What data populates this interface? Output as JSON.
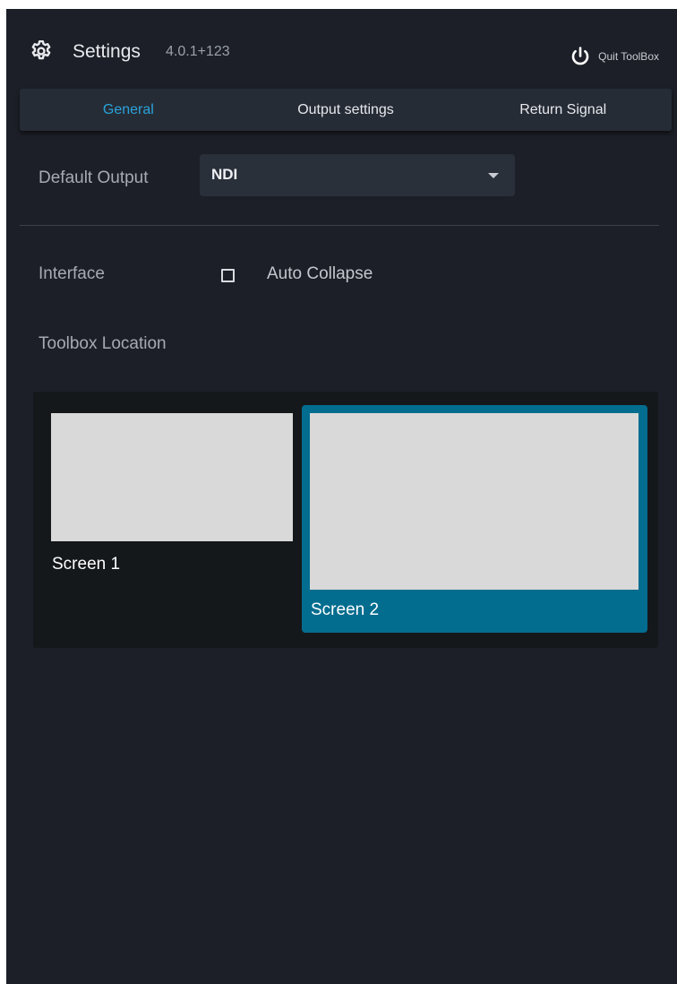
{
  "header": {
    "title": "Settings",
    "version": "4.0.1+123",
    "quit_label": "Quit ToolBox",
    "icons": {
      "settings": "gear-icon",
      "quit": "power-icon"
    }
  },
  "tabs": [
    {
      "label": "General",
      "active": true
    },
    {
      "label": "Output settings",
      "active": false
    },
    {
      "label": "Return Signal",
      "active": false
    }
  ],
  "general": {
    "default_output": {
      "label": "Default Output",
      "value": "NDI"
    },
    "interface": {
      "label": "Interface",
      "auto_collapse": {
        "label": "Auto Collapse",
        "checked": false
      }
    },
    "toolbox_location": {
      "label": "Toolbox Location",
      "screens": [
        {
          "name": "Screen 1",
          "selected": false
        },
        {
          "name": "Screen 2",
          "selected": true
        }
      ]
    }
  },
  "colors": {
    "background": "#1c1f27",
    "accent": "#29a3da",
    "selected_screen": "#036d8f",
    "tab_bar": "#262c36"
  }
}
